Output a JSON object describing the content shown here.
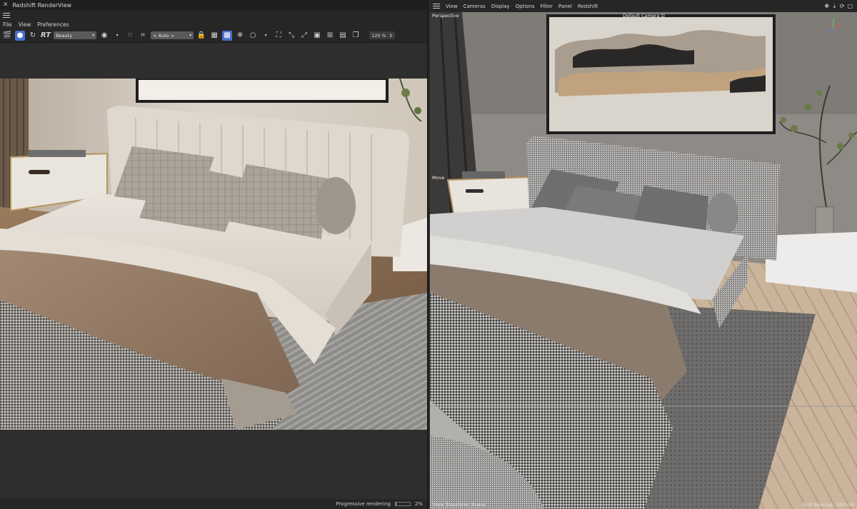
{
  "render_view": {
    "window_title": "Redshift RenderView",
    "menu": [
      "File",
      "View",
      "Preferences"
    ],
    "toolbar": {
      "rt_label": "RT",
      "aov_select": "Beauty",
      "camera_select": "< Auto >",
      "zoom": "120 %"
    },
    "status": {
      "text": "Progressive rendering",
      "percent_label": "2%",
      "progress": 0.02
    }
  },
  "viewport": {
    "menu": [
      "View",
      "Cameras",
      "Display",
      "Options",
      "Filter",
      "Panel",
      "Redshift"
    ],
    "perspective_label": "Perspective",
    "camera_label": "Default Camera",
    "tool_label": "Move",
    "status_left": "View Transform: Scene",
    "status_right": "Grid Spacing : 500 cm"
  }
}
